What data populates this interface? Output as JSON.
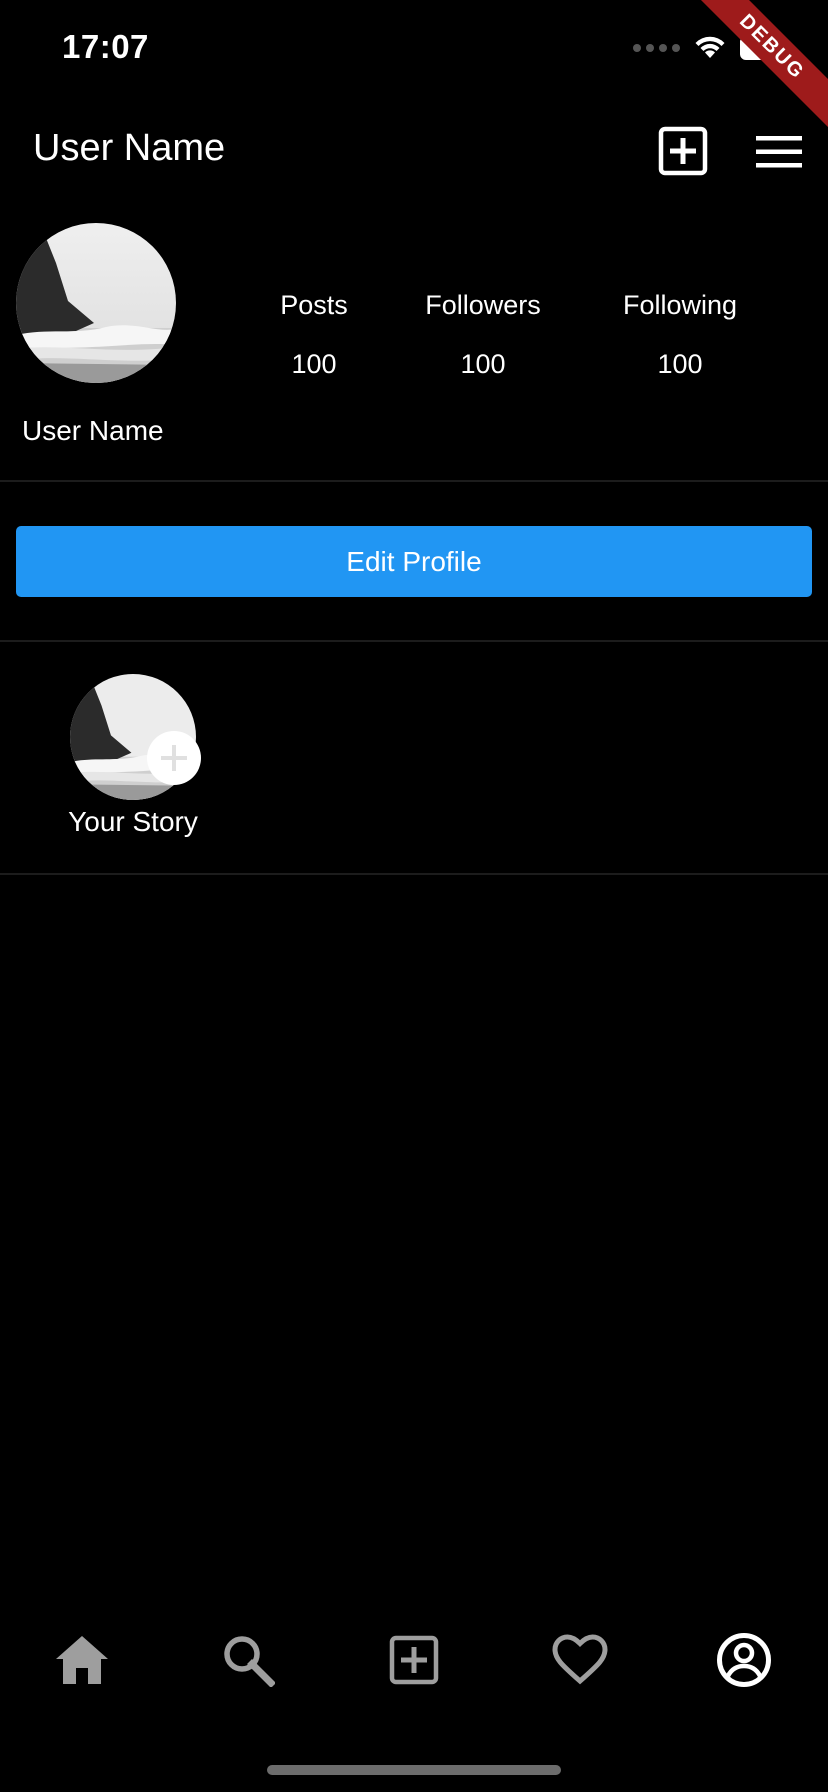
{
  "status_bar": {
    "time": "17:07"
  },
  "debug_banner": "DEBUG",
  "app_bar": {
    "title": "User Name",
    "add_icon": "add-box-icon",
    "menu_icon": "menu-icon"
  },
  "profile": {
    "name": "User Name",
    "stats": [
      {
        "label": "Posts",
        "value": "100"
      },
      {
        "label": "Followers",
        "value": "100"
      },
      {
        "label": "Following",
        "value": "100"
      }
    ],
    "edit_button": "Edit Profile"
  },
  "story": {
    "label": "Your Story"
  },
  "bottom_nav": {
    "items": [
      {
        "icon": "home-icon"
      },
      {
        "icon": "search-icon"
      },
      {
        "icon": "add-box-icon"
      },
      {
        "icon": "heart-icon"
      },
      {
        "icon": "account-circle-icon"
      }
    ]
  },
  "colors": {
    "background": "#000000",
    "accent": "#2196f3",
    "debug": "#9e1b1b",
    "nav_inactive": "#9e9e9e"
  }
}
